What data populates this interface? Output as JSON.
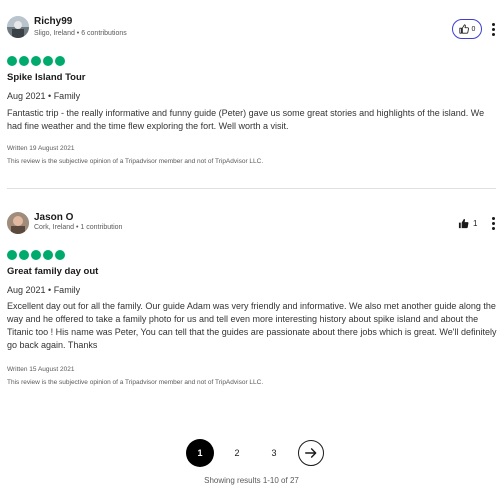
{
  "reviews": [
    {
      "author": "Richy99",
      "meta": "Sligo, Ireland • 6 contributions",
      "helpful_count": "0",
      "rating": 5,
      "title": "Spike Island Tour",
      "trip": "Aug 2021 • Family",
      "body": "Fantastic trip - the really informative and funny guide (Peter) gave us some great stories and highlights of the island. We had fine weather and the time flew exploring the fort. Well worth a visit.",
      "written": "Written 19 August 2021",
      "disclaimer": "This review is the subjective opinion of a Tripadvisor member and not of TripAdvisor LLC."
    },
    {
      "author": "Jason O",
      "meta": "Cork, Ireland • 1 contribution",
      "helpful_count": "1",
      "rating": 5,
      "title": "Great family day out",
      "trip": "Aug 2021 • Family",
      "body": "Excellent day out for all the family. Our guide Adam was very friendly and informative. We also met another guide along the way and he offered to take a family photo for us and tell even more interesting history about spike island and about the Titanic too ! His name was Peter, You can tell that the guides are passionate about there jobs which is great. We'll definitely go back again. Thanks",
      "written": "Written 15 August 2021",
      "disclaimer": "This review is the subjective opinion of a Tripadvisor member and not of TripAdvisor LLC."
    }
  ],
  "pagination": {
    "current": "1",
    "pages": [
      "2",
      "3"
    ],
    "results_text": "Showing results 1-10 of 27"
  },
  "colors": {
    "bubble": "#00aa6c",
    "accent": "#3d3ed6"
  },
  "icons": {
    "helpful": "thumbs-up-icon",
    "more": "more-vertical-icon",
    "next": "arrow-right-circle-icon"
  }
}
